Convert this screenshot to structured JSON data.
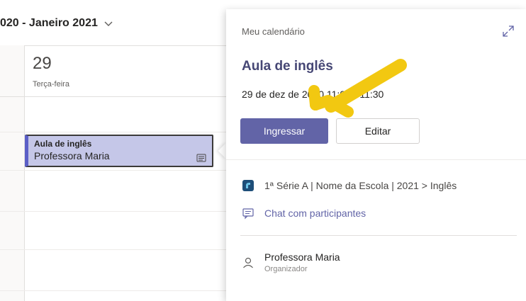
{
  "header": {
    "range_title": "020 - Janeiro 2021"
  },
  "day": {
    "number": "29",
    "name": "Terça-feira"
  },
  "event": {
    "title": "Aula de inglês",
    "organizer": "Professora Maria"
  },
  "popup": {
    "calendar_label": "Meu calendário",
    "title": "Aula de inglês",
    "time": "29 de dez de 2020 11:00 - 11:30",
    "join_label": "Ingressar",
    "edit_label": "Editar",
    "channel": "1ª Série A | Nome da Escola | 2021 > Inglês",
    "chat_label": "Chat com participantes",
    "organizer_name": "Professora Maria",
    "organizer_role": "Organizador"
  },
  "colors": {
    "accent": "#6264a7",
    "event_fill": "#c5c7e8",
    "title_color": "#464775",
    "annotation_arrow": "#f2c811"
  }
}
